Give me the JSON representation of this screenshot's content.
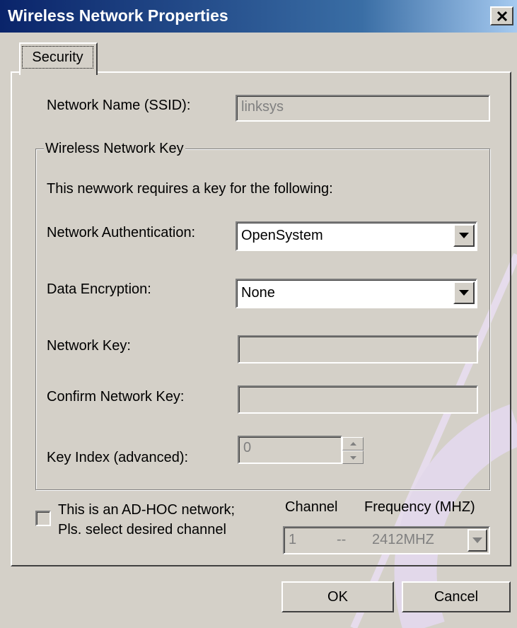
{
  "window": {
    "title": "Wireless Network Properties",
    "close_glyph": "×"
  },
  "tabs": [
    {
      "label": "Security",
      "active": true
    }
  ],
  "security": {
    "ssid": {
      "label": "Network Name (SSID):",
      "value": "linksys",
      "enabled": false
    },
    "key_group": {
      "title": "Wireless Network Key",
      "intro": "This newwork requires a key for the following:",
      "authentication": {
        "label": "Network Authentication:",
        "value": "OpenSystem"
      },
      "encryption": {
        "label": "Data Encryption:",
        "value": "None"
      },
      "network_key": {
        "label": "Network Key:",
        "value": ""
      },
      "confirm_key": {
        "label": "Confirm Network Key:",
        "value": ""
      },
      "key_index": {
        "label": "Key Index (advanced):",
        "value": "0"
      }
    },
    "adhoc": {
      "checked": false,
      "line1": "This is an AD-HOC network;",
      "line2": "Pls. select desired channel",
      "channel_header": "Channel",
      "frequency_header": "Frequency (MHZ)",
      "channel_value": "1",
      "separator": "--",
      "frequency_value": "2412MHZ"
    }
  },
  "buttons": {
    "ok": "OK",
    "cancel": "Cancel"
  },
  "colors": {
    "face": "#d4d0c8",
    "title_start": "#0a246a",
    "title_end": "#a6caf0",
    "disabled_text": "#808080",
    "watermark": "#e4dcec"
  }
}
